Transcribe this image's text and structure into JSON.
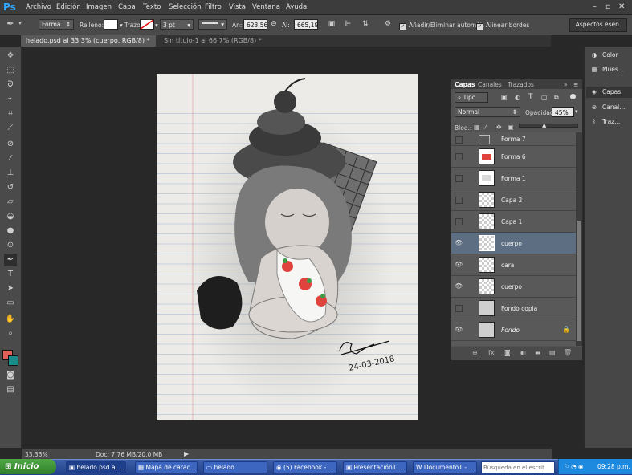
{
  "app": {
    "logo": "Ps"
  },
  "menu": [
    "Archivo",
    "Edición",
    "Imagen",
    "Capa",
    "Texto",
    "Selección",
    "Filtro",
    "Vista",
    "Ventana",
    "Ayuda"
  ],
  "options": {
    "tool_mode": "Forma",
    "fill_label": "Relleno:",
    "stroke_label": "Trazo:",
    "stroke_size": "3 pt",
    "width_label": "An:",
    "width_value": "623,56",
    "height_label": "Al:",
    "height_value": "665,19",
    "auto_add_delete": "Añadir/Eliminar automát.",
    "align_edges": "Alinear bordes",
    "workspace": "Aspectos esen."
  },
  "tabs": [
    {
      "label": "helado.psd al 33,3% (cuerpo, RGB/8) *"
    },
    {
      "label": "Sin título-1 al 66,7% (RGB/8) *"
    }
  ],
  "status": {
    "zoom": "33,33%",
    "doc": "Doc: 7,76 MB/20,0 MB"
  },
  "dock": {
    "color": "Color",
    "swatches": "Mues...",
    "layers": "Capas",
    "channels": "Canal...",
    "paths": "Traz..."
  },
  "layers_panel": {
    "tabs": [
      "Capas",
      "Canales",
      "Trazados"
    ],
    "filter": "Tipo",
    "blend_mode": "Normal",
    "opacity_label": "Opacidad:",
    "opacity": "45%",
    "lock_label": "Bloq.:",
    "layers": [
      {
        "name": "Forma 7",
        "visible": false
      },
      {
        "name": "Forma 6",
        "visible": false
      },
      {
        "name": "Forma 1",
        "visible": false
      },
      {
        "name": "Capa 2",
        "visible": false
      },
      {
        "name": "Capa 1",
        "visible": false
      },
      {
        "name": "cuerpo",
        "visible": true,
        "selected": true
      },
      {
        "name": "cara",
        "visible": true
      },
      {
        "name": "cuerpo",
        "visible": true
      },
      {
        "name": "Fondo copia",
        "visible": false
      },
      {
        "name": "Fondo",
        "visible": true
      }
    ]
  },
  "artwork": {
    "signature": "Bu...",
    "date": "24-03-2018"
  },
  "colors": {
    "foreground": "#e0605a",
    "background": "#1a8a8a"
  },
  "taskbar": {
    "start": "Inicio",
    "tasks": [
      "helado.psd al ...",
      "Mapa de carac...",
      "helado",
      "(5) Facebook - ...",
      "Presentación1 ...",
      "Documento1 - ..."
    ],
    "search_placeholder": "Búsqueda en el escrit",
    "clock": "09:28 p.m."
  }
}
